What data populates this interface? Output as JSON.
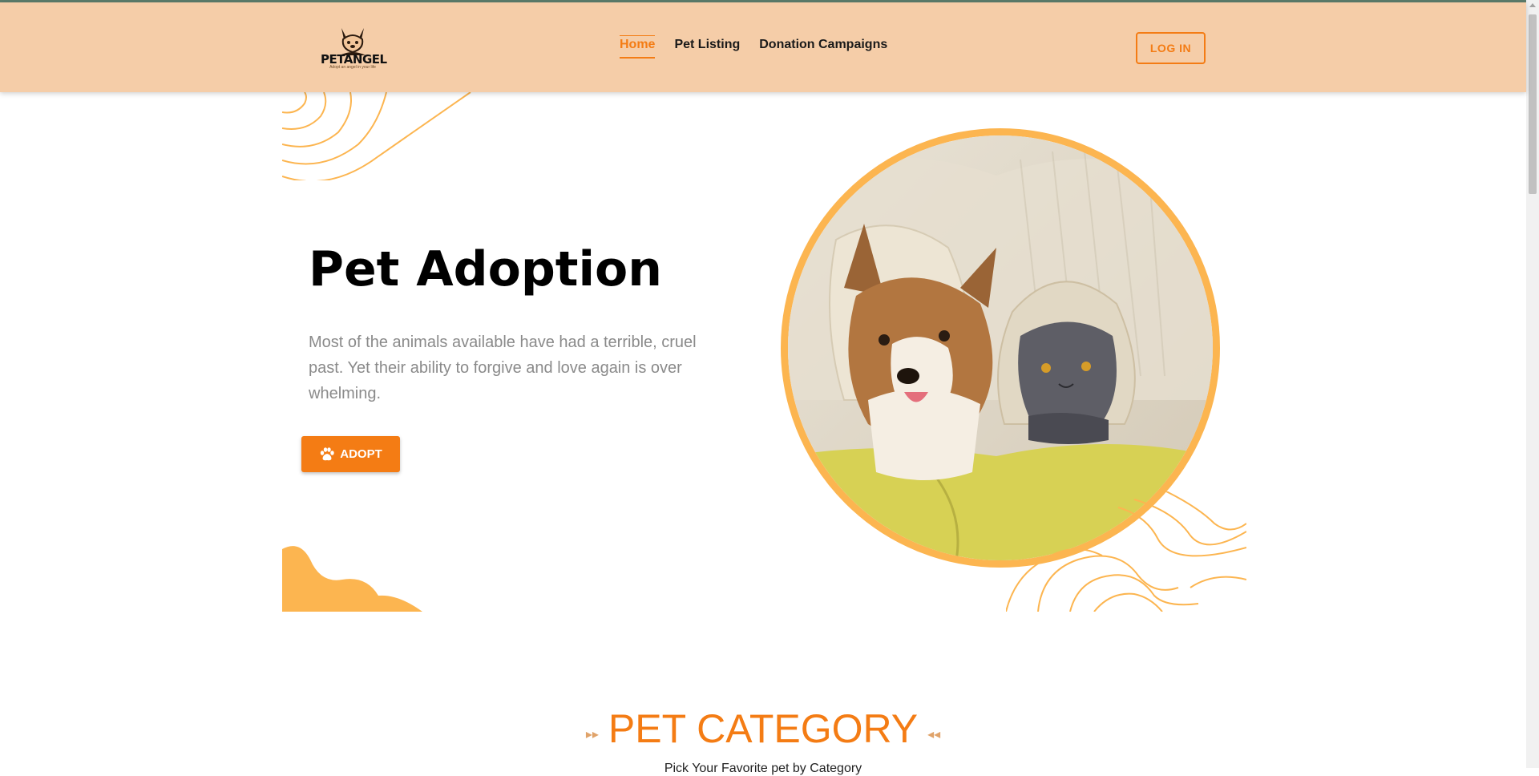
{
  "brand": {
    "name": "PETANGEL",
    "tagline": "Adopt an angel in your life"
  },
  "nav": {
    "links": [
      {
        "label": "Home",
        "active": true
      },
      {
        "label": "Pet Listing",
        "active": false
      },
      {
        "label": "Donation Campaigns",
        "active": false
      }
    ],
    "login_label": "LOG IN"
  },
  "hero": {
    "title": "Pet Adoption",
    "description": "Most of the animals available have had a terrible, cruel past. Yet their ability to forgive and love again is over whelming.",
    "adopt_label": "ADOPT",
    "adopt_icon": "paw-icon",
    "image_alt": "corgi-and-cat-under-blanket"
  },
  "category_section": {
    "title": "PET CATEGORY",
    "subtitle": "Pick Your Favorite pet by Category"
  },
  "colors": {
    "accent": "#f47c14",
    "navbar_bg": "#f5cda8",
    "decoration": "#fcb550"
  }
}
